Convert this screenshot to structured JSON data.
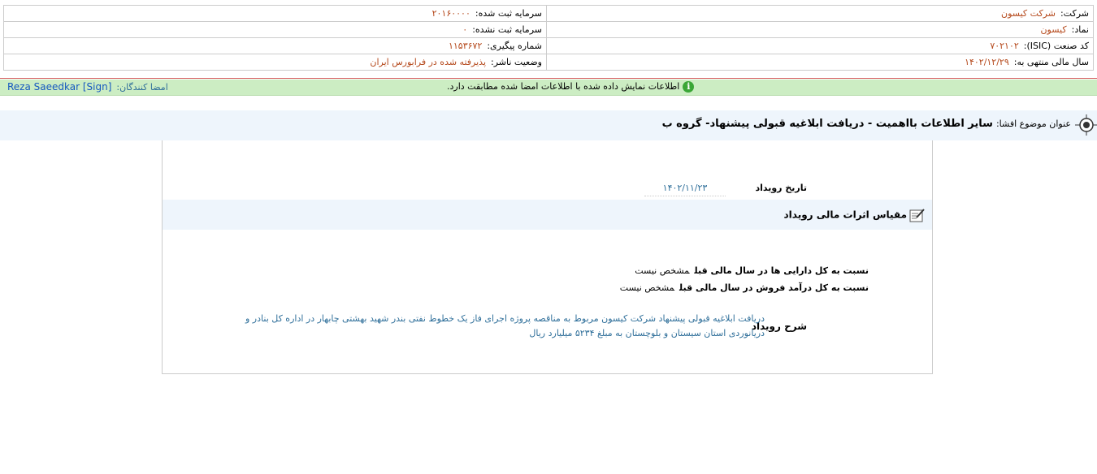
{
  "header": {
    "company_label": "شرکت:",
    "company_value": "شرکت کیسون",
    "registered_capital_label": "سرمایه ثبت شده:",
    "registered_capital_value": "۲۰۱۶۰۰۰۰",
    "symbol_label": "نماد:",
    "symbol_value": "کیسون",
    "unregistered_capital_label": "سرمایه ثبت نشده:",
    "unregistered_capital_value": "۰",
    "isic_label": "کد صنعت (ISIC):",
    "isic_value": "۷۰۲۱۰۲",
    "tracking_label": "شماره پیگیری:",
    "tracking_value": "۱۱۵۳۶۷۲",
    "fiscal_year_label": "سال مالی منتهی به:",
    "fiscal_year_value": "۱۴۰۲/۱۲/۲۹",
    "publisher_status_label": "وضعیت ناشر:",
    "publisher_status_value": "پذیرفته شده در فرابورس ایران"
  },
  "notice": {
    "message": "اطلاعات نمایش داده شده با اطلاعات امضا شده مطابقت دارد.",
    "icon": "info-icon",
    "signers_label": "امضا کنندگان:",
    "signers_value": "Reza Saeedkar [Sign]"
  },
  "subject": {
    "label": "عنوان موضوع افشا:",
    "value": "سایر اطلاعات بااهمیت - دریافت ابلاغیه قبولی پیشنهاد- گروه ب"
  },
  "event": {
    "date_label": "تاریخ رویداد",
    "date_value": "۱۴۰۲/۱۱/۲۳",
    "section_title": "مقیاس اثرات مالی رویداد",
    "measures": [
      {
        "label": "نسبت به کل دارایی ها در سال مالی قبل",
        "value": "مشخص نیست"
      },
      {
        "label": "نسبت به کل درآمد فروش در سال مالی قبل",
        "value": "مشخص نیست"
      }
    ],
    "description_label": "شرح رویداد",
    "description_value": "دریافت ابلاغیه قبولی پیشنهاد شرکت کیسون مربوط به مناقصه پروژه اجرای فاز یک خطوط نفتی بندر شهید بهشتی چابهار در اداره کل بنادر و دریانوردی استان سیستان و بلوچستان به مبلغ ۵۲۳۴ میلیارد ریال"
  },
  "colors": {
    "value_orange": "#b5491c",
    "notice_green": "#ccedc3",
    "link_blue": "#2f6f9a"
  }
}
